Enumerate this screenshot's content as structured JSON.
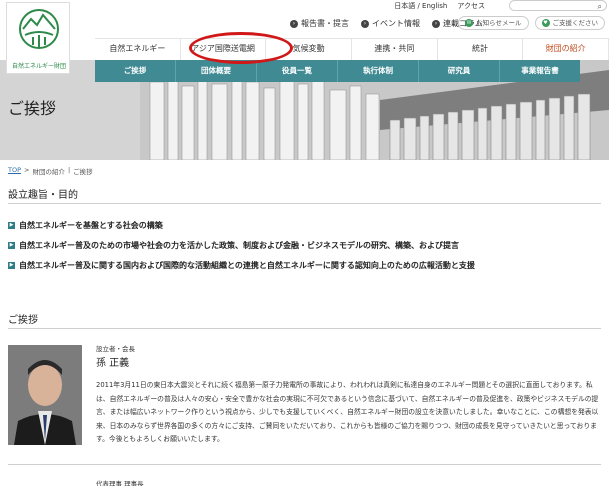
{
  "logo": {
    "text": "自然エネルギー財団"
  },
  "top_links": [
    "日本語 / English",
    "アクセス"
  ],
  "sub_nav": [
    {
      "label": "報告書・提言"
    },
    {
      "label": "イベント情報"
    },
    {
      "label": "連載コラム"
    }
  ],
  "mail_buttons": [
    "お知らせメール",
    "ご支援ください"
  ],
  "main_nav": [
    {
      "label": "自然エネルギー"
    },
    {
      "label": "アジア国際送電網"
    },
    {
      "label": "気候変動"
    },
    {
      "label": "連携・共同"
    },
    {
      "label": "統計"
    },
    {
      "label": "財団の紹介"
    }
  ],
  "about_nav": [
    "ご挨拶",
    "団体概要",
    "役員一覧",
    "執行体制",
    "研究員",
    "事業報告書"
  ],
  "hero_title": "ご挨拶",
  "breadcrumb": {
    "top": "TOP",
    "sep1": ">",
    "level1": "財団の紹介",
    "sep2": "|",
    "current": "ご挨拶"
  },
  "purpose": {
    "title": "設立趣旨・目的",
    "items": [
      "自然エネルギーを基盤とする社会の構築",
      "自然エネルギー普及のための市場や社会の力を活かした政策、制度および金融・ビジネスモデルの研究、構築、および提言",
      "自然エネルギー普及に関する国内および国際的な活動組織との連携と自然エネルギーに関する認知向上のための広報活動と支援"
    ]
  },
  "greeting": {
    "title": "ご挨拶",
    "role": "設立者・会長",
    "name": "孫 正義",
    "paragraph": "2011年3月11日の東日本大震災とそれに続く福島第一原子力発電所の事故により、われわれは真剣に私達自身のエネルギー問題とその選択に直面しております。私は、自然エネルギーの普及は人々の安心・安全で豊かな社会の実現に不可欠であるという信念に基づいて、自然エネルギーの普及促進を、政策やビジネスモデルの提言、または幅広いネットワーク作りという視点から、少しでも支援していくべく、自然エネルギー財団の設立を決意いたしました。幸いなことに、この構想を発表以来、日本のみならず世界各国の多くの方々にご支持、ご賛同をいただいており、これからも皆様のご協力を賜りつつ、財団の成長を見守っていきたいと思っております。今後ともよろしくお願いいたします。",
    "next_role": "代表理事 理事長"
  },
  "colors": {
    "teal": "#3f8a93",
    "accent": "#c14a1c",
    "circle": "#d01818",
    "logo_green": "#2d8a49"
  }
}
